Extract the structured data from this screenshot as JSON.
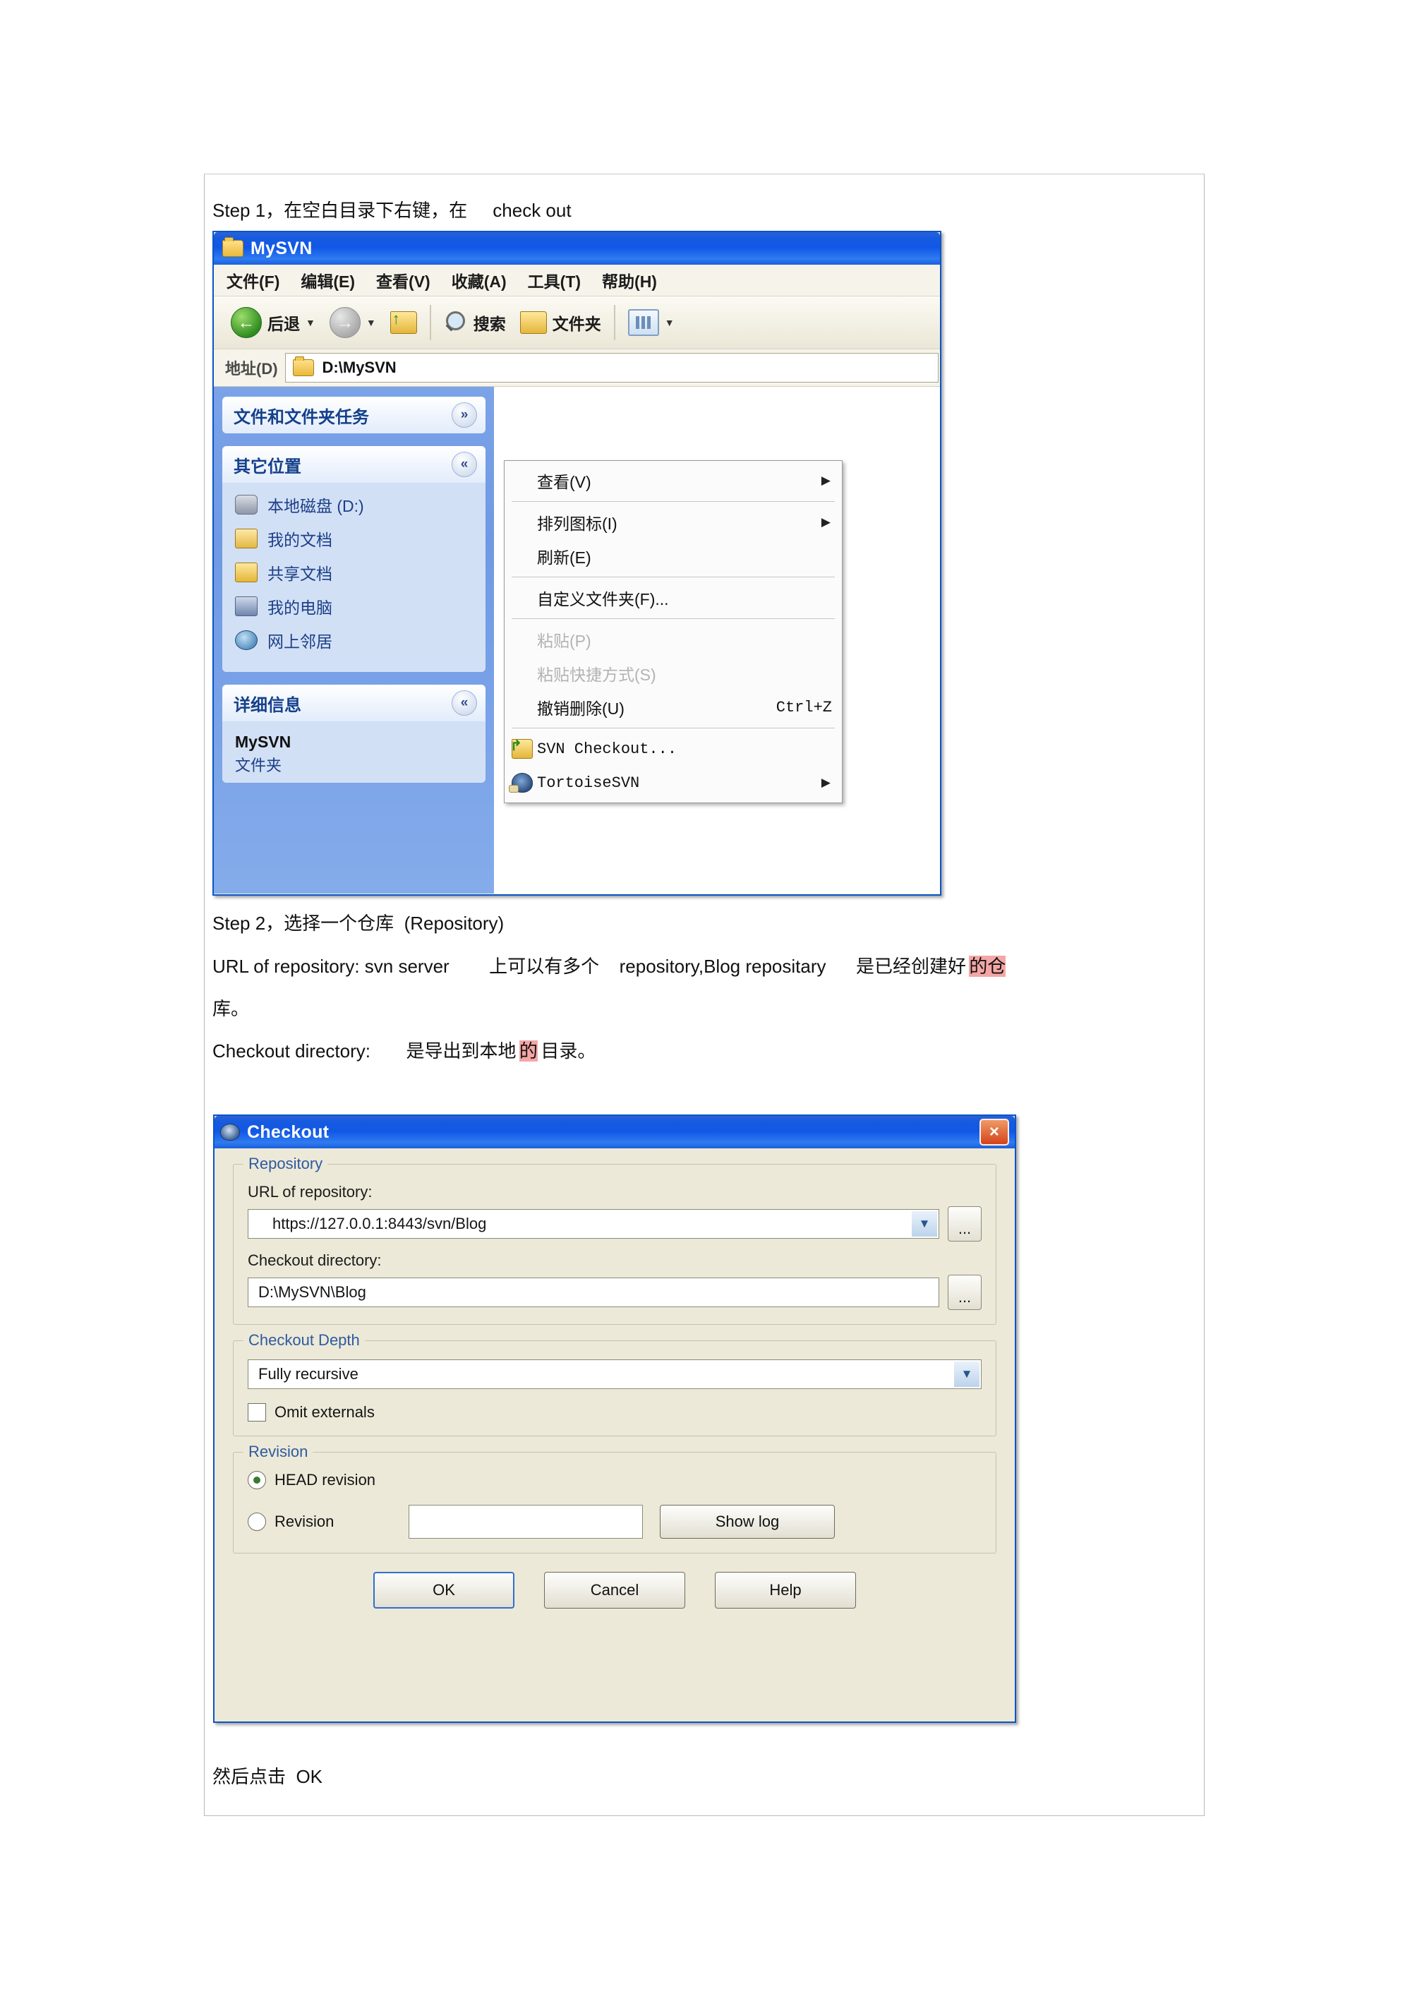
{
  "document": {
    "step1_text": "Step 1，在空白目录下右键，在     check out",
    "step2_text": "Step 2，选择一个仓库  (Repository)",
    "url_line_a": "URL of repository: svn server",
    "url_line_b": "上可以有多个",
    "url_line_c": "repository,Blog repositary",
    "url_line_d": "是已经创建好",
    "url_line_e_highlight": "的仓",
    "url_line_f": "库。",
    "checkout_dir_line_a": "Checkout directory:",
    "checkout_dir_line_b": "是导出到本地",
    "checkout_dir_highlight": "的",
    "checkout_dir_line_c": "目录。",
    "footer_text": "然后点击  OK",
    "highlight_color": "#f4a6a6"
  },
  "explorer": {
    "title": "MySVN",
    "menus": [
      "文件(F)",
      "编辑(E)",
      "查看(V)",
      "收藏(A)",
      "工具(T)",
      "帮助(H)"
    ],
    "toolbar": {
      "back_label": "后退",
      "search_label": "搜索",
      "folders_label": "文件夹"
    },
    "address": {
      "label": "地址(D)",
      "value": "D:\\MySVN"
    },
    "panels": [
      {
        "title": "文件和文件夹任务",
        "chevron": "chevron-down-icon",
        "glyph": "»"
      },
      {
        "title": "其它位置",
        "chevron": "chevron-up-icon",
        "glyph": "«"
      },
      {
        "title": "详细信息",
        "chevron": "chevron-up-icon",
        "glyph": "«"
      }
    ],
    "other_places": [
      {
        "label": "本地磁盘 (D:)",
        "icon": "hard-disk-icon"
      },
      {
        "label": "我的文档",
        "icon": "my-documents-icon"
      },
      {
        "label": "共享文档",
        "icon": "shared-documents-icon"
      },
      {
        "label": "我的电脑",
        "icon": "my-computer-icon"
      },
      {
        "label": "网上邻居",
        "icon": "network-places-icon"
      }
    ],
    "details": {
      "name": "MySVN",
      "type": "文件夹"
    },
    "context_menu": [
      {
        "label": "查看(V)",
        "arrow": "▶",
        "disabled": false
      },
      {
        "label": "排列图标(I)",
        "arrow": "▶",
        "disabled": false
      },
      {
        "label": "刷新(E)",
        "arrow": "",
        "disabled": false
      },
      {
        "label": "自定义文件夹(F)...",
        "arrow": "",
        "disabled": false
      },
      {
        "label": "粘贴(P)",
        "arrow": "",
        "disabled": true
      },
      {
        "label": "粘贴快捷方式(S)",
        "arrow": "",
        "disabled": true
      },
      {
        "label": "撤销删除(U)",
        "accel": "Ctrl+Z",
        "arrow": "",
        "disabled": false
      },
      {
        "label": "SVN Checkout...",
        "arrow": "",
        "icon": "svn-checkout-icon",
        "disabled": false
      },
      {
        "label": "TortoiseSVN",
        "arrow": "▶",
        "icon": "tortoise-icon",
        "disabled": false
      }
    ]
  },
  "checkout_dialog": {
    "title": "Checkout",
    "close_glyph": "×",
    "groups": {
      "repository": {
        "title": "Repository",
        "url_label": "URL of repository:",
        "url_value": "https://127.0.0.1:8443/svn/Blog",
        "dir_label": "Checkout directory:",
        "dir_value": "D:\\MySVN\\Blog",
        "browse_label": "..."
      },
      "depth": {
        "title": "Checkout Depth",
        "value": "Fully recursive",
        "omit_externals_label": "Omit externals",
        "omit_externals_checked": false
      },
      "revision": {
        "title": "Revision",
        "head_label": "HEAD revision",
        "head_selected": true,
        "revision_label": "Revision",
        "revision_selected": false,
        "revision_value": "",
        "show_log_label": "Show log"
      }
    },
    "buttons": {
      "ok": "OK",
      "cancel": "Cancel",
      "help": "Help"
    }
  }
}
